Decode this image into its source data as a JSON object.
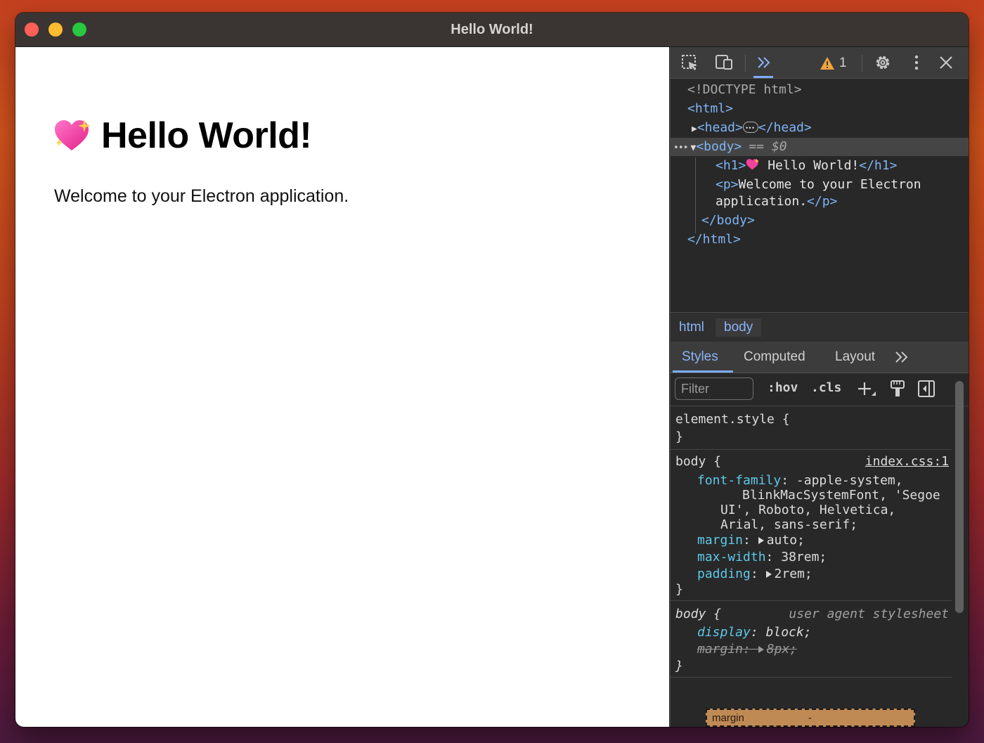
{
  "window": {
    "title": "Hello World!"
  },
  "page": {
    "heading": "Hello World!",
    "heading_emoji": "sparkling-heart",
    "paragraph": "Welcome to your Electron application."
  },
  "devtools": {
    "toolbar": {
      "warning_count": "1",
      "icons": [
        "inspect-element-icon",
        "device-toolbar-icon",
        "more-tabs-icon",
        "warning-icon",
        "settings-icon",
        "kebab-menu-icon",
        "close-icon"
      ]
    },
    "elements": {
      "doctype": "<!DOCTYPE html>",
      "html_open": "<html>",
      "head_open": "<head>",
      "head_close": "</head>",
      "body_open": "<body>",
      "selected_marker": "== $0",
      "h1_open": "<h1>",
      "h1_text": " Hello World!",
      "h1_close": "</h1>",
      "p_open": "<p>",
      "p_text_1": "Welcome to your Electron",
      "p_text_2": "application.",
      "p_close": "</p>",
      "body_close": "</body>",
      "html_close": "</html>"
    },
    "breadcrumb": [
      "html",
      "body"
    ],
    "subtabs": [
      "Styles",
      "Computed",
      "Layout"
    ],
    "styles_toolbar": {
      "filter_placeholder": "Filter",
      "hov": ":hov",
      "cls": ".cls"
    },
    "rules": {
      "element_style": {
        "selector": "element.style {",
        "close": "}"
      },
      "body_rule": {
        "selector": "body {",
        "source": "index.css:1",
        "font_family_name": "font-family",
        "font_family_value_1": ": -apple-system,",
        "font_family_value_2": "BlinkMacSystemFont, 'Segoe",
        "font_family_value_3": "UI', Roboto, Helvetica,",
        "font_family_value_4": "Arial, sans-serif;",
        "margin_name": "margin",
        "margin_value": "auto;",
        "max_width_name": "max-width",
        "max_width_value": "38rem;",
        "padding_name": "padding",
        "padding_value": "2rem;",
        "close": "}"
      },
      "ua_rule": {
        "selector": "body {",
        "source": "user agent stylesheet",
        "display_name": "display",
        "display_value": "block;",
        "margin_name": "margin:",
        "margin_value": "8px;",
        "close": "}"
      }
    },
    "box_model": {
      "label": "margin",
      "value": "-"
    }
  },
  "colors": {
    "tag_blue": "#7fb4f5",
    "prop_cyan": "#5ec8e8",
    "accent": "#7cacf8",
    "margin_box": "#c08a55"
  }
}
